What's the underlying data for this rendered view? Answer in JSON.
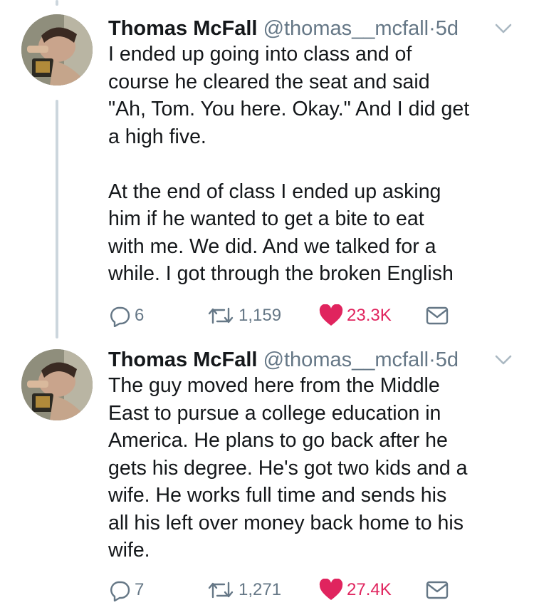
{
  "tweets": [
    {
      "author": {
        "name": "Thomas McFall",
        "handle": "@thomas__mcfall"
      },
      "dot": "·",
      "time": "5d",
      "text": "I ended up going into class and of\ncourse he cleared the seat and said\n\"Ah, Tom. You here. Okay.\" And I did get\na high five.\n\nAt the end of class I ended up asking\nhim if he wanted to get a bite to eat\nwith me. We did. And we talked for a\nwhile. I got through the broken English",
      "replies": "6",
      "retweets": "1,159",
      "likes": "23.3K"
    },
    {
      "author": {
        "name": "Thomas McFall",
        "handle": "@thomas__mcfall"
      },
      "dot": "·",
      "time": "5d",
      "text": "The guy moved here from the Middle\nEast to pursue a college education in\nAmerica. He plans to go back after he\ngets his degree. He's got two kids and a\nwife. He works full time and sends his\nall his left over money back home to his\nwife.",
      "replies": "7",
      "retweets": "1,271",
      "likes": "27.4K"
    }
  ],
  "colors": {
    "like": "#e0245e",
    "muted": "#657786",
    "thread": "#ccd6dd"
  }
}
